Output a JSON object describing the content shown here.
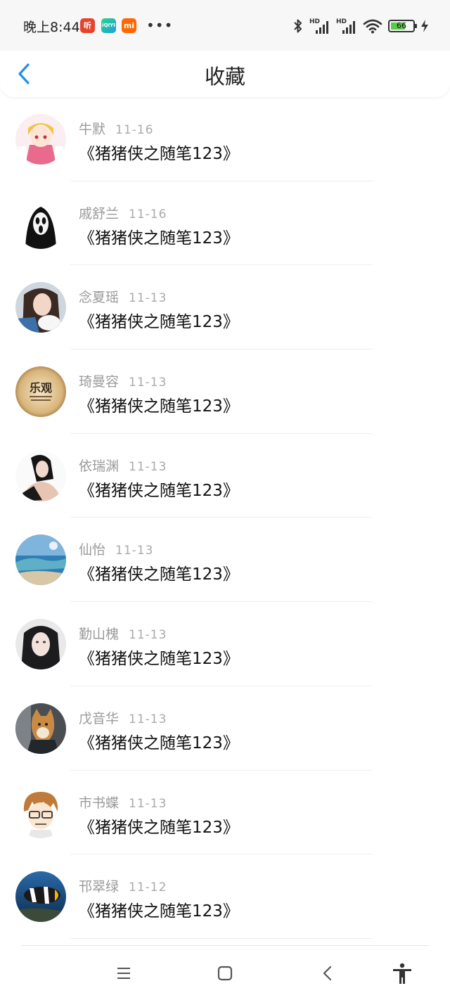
{
  "status_bar": {
    "time": "晚上8:44",
    "apps": [
      {
        "name": "ting",
        "label": "听",
        "color": "#e5432e"
      },
      {
        "name": "iqiyi",
        "label": "iQIYI",
        "color": "#1fbf7f"
      },
      {
        "name": "mi",
        "label": "mi",
        "color": "#ff6700"
      }
    ],
    "more": "•••",
    "signal_labels": [
      "HD",
      "HD"
    ],
    "battery_level": "66"
  },
  "header": {
    "title": "收藏",
    "accent_color": "#1e90e8"
  },
  "favorites": [
    {
      "author": "牛默",
      "date": "11-16",
      "title": "《猪猪侠之随笔123》"
    },
    {
      "author": "戚舒兰",
      "date": "11-16",
      "title": "《猪猪侠之随笔123》"
    },
    {
      "author": "念夏瑶",
      "date": "11-13",
      "title": "《猪猪侠之随笔123》"
    },
    {
      "author": "琦曼容",
      "date": "11-13",
      "title": "《猪猪侠之随笔123》"
    },
    {
      "author": "依瑞渊",
      "date": "11-13",
      "title": "《猪猪侠之随笔123》"
    },
    {
      "author": "仙怡",
      "date": "11-13",
      "title": "《猪猪侠之随笔123》"
    },
    {
      "author": "勤山槐",
      "date": "11-13",
      "title": "《猪猪侠之随笔123》"
    },
    {
      "author": "戊音华",
      "date": "11-13",
      "title": "《猪猪侠之随笔123》"
    },
    {
      "author": "市书蝶",
      "date": "11-13",
      "title": "《猪猪侠之随笔123》"
    },
    {
      "author": "邗翠绿",
      "date": "11-12",
      "title": "《猪猪侠之随笔123》"
    }
  ],
  "avatar_4_text": "乐观",
  "nav_bar": {
    "buttons": [
      "menu-icon",
      "home-icon",
      "back-icon",
      "accessibility-icon"
    ]
  }
}
